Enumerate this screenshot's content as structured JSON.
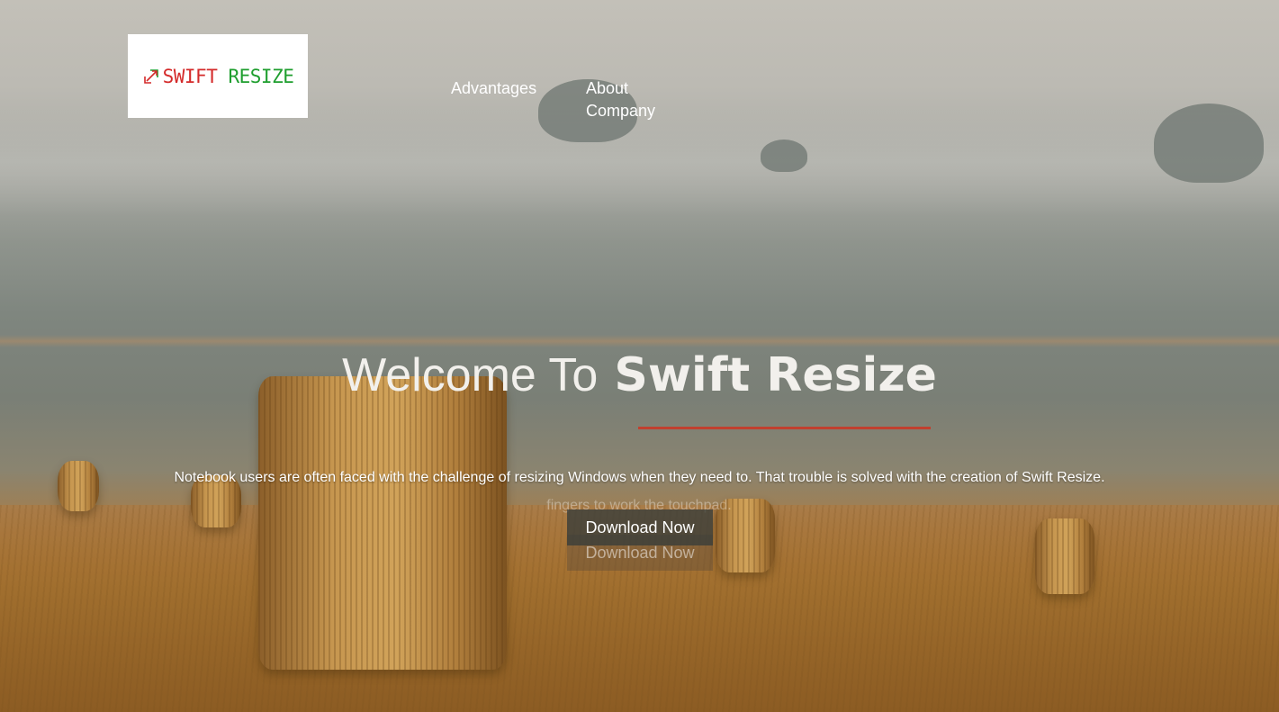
{
  "header": {
    "logo": {
      "text_swift": "SWIFT",
      "text_resize": "RESIZE",
      "icon": "resize-arrow-icon"
    },
    "nav": [
      {
        "label": "Advantages"
      },
      {
        "label": "About Company"
      }
    ]
  },
  "hero": {
    "title_light": "Welcome To",
    "title_bold": "Swift Resize",
    "tagline": "Notebook users are often faced with the challenge of resizing Windows when they need to. That trouble is solved with the creation of Swift Resize.",
    "tagline_ghost": "fingers to work the touchpad.",
    "download_label": "Download Now",
    "download_ghost_label": "Download Now"
  },
  "colors": {
    "accent_red": "#c1402f",
    "logo_red": "#d42a2a",
    "logo_green": "#1e9e2e"
  }
}
